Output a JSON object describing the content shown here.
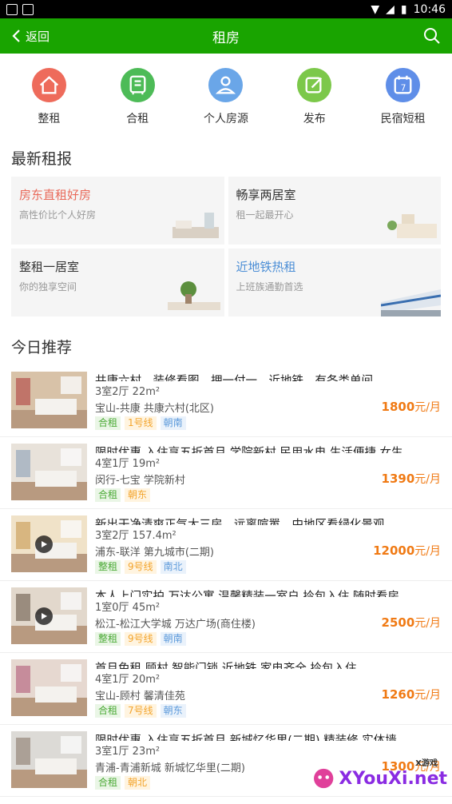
{
  "status": {
    "time": "10:46"
  },
  "header": {
    "back_label": "返回",
    "title": "租房"
  },
  "categories": [
    {
      "label": "整租",
      "color": "#ee6b5b",
      "icon": "home-icon"
    },
    {
      "label": "合租",
      "color": "#4dbb57",
      "icon": "building-icon"
    },
    {
      "label": "个人房源",
      "color": "#6aa6e8",
      "icon": "person-icon"
    },
    {
      "label": "发布",
      "color": "#7cc84a",
      "icon": "edit-icon"
    },
    {
      "label": "民宿短租",
      "color": "#5f8ee8",
      "icon": "calendar-icon"
    }
  ],
  "latest": {
    "title": "最新租报",
    "promos": [
      {
        "title": "房东直租好房",
        "sub": "高性价比个人好房",
        "color": "#e96a5a"
      },
      {
        "title": "畅享两居室",
        "sub": "租一起最开心",
        "color": "#333333"
      },
      {
        "title": "整租一居室",
        "sub": "你的独享空间",
        "color": "#333333"
      },
      {
        "title": "近地铁热租",
        "sub": "上班族通勤首选",
        "color": "#4d8fd6"
      }
    ]
  },
  "recommend": {
    "title": "今日推荐",
    "items": [
      {
        "title": "共康六村，装修看图，押一付一，近地铁，有各类单间，...",
        "layout": "3室2厅  22m²",
        "location": "宝山-共康  共康六村(北区)",
        "price": "1800",
        "unit": "元/月",
        "tags": [
          "合租",
          "1号线",
          "朝南"
        ],
        "video": false
      },
      {
        "title": "限时优惠 入住享五折首月 学院新村 民用水电 生活便捷 女生",
        "layout": "4室1厅  19m²",
        "location": "闵行-七宝  学院新村",
        "price": "1390",
        "unit": "元/月",
        "tags": [
          "合租",
          "朝东"
        ],
        "video": false
      },
      {
        "title": "新出干净清爽正气大三房，远离喧嚣，中地区看绿化景观...",
        "layout": "3室2厅  157.4m²",
        "location": "浦东-联洋  第九城市(二期)",
        "price": "12000",
        "unit": "元/月",
        "tags": [
          "整租",
          "9号线",
          "南北"
        ],
        "video": true
      },
      {
        "title": "本人上门实拍 万达公寓 温馨精装一室户 拎包入住 随时看房",
        "layout": "1室0厅  45m²",
        "location": "松江-松江大学城  万达广场(商住楼)",
        "price": "2500",
        "unit": "元/月",
        "tags": [
          "整租",
          "9号线",
          "朝南"
        ],
        "video": true
      },
      {
        "title": "首月免租 顾村 智能门锁 近地铁 家电齐全 拎包入住",
        "layout": "4室1厅  20m²",
        "location": "宝山-顾村  馨清佳苑",
        "price": "1260",
        "unit": "元/月",
        "tags": [
          "合租",
          "7号线",
          "朝东"
        ],
        "video": false
      },
      {
        "title": "限时优惠 入住享五折首月 新城忆华里(二期) 精装修 实体墙",
        "layout": "3室1厅  23m²",
        "location": "青浦-青浦新城  新城忆华里(二期)",
        "price": "1300",
        "unit": "元/月",
        "tags": [
          "合租",
          "朝北"
        ],
        "video": false
      }
    ]
  },
  "watermark": {
    "text": "XYouXi.net",
    "small": "X游戏"
  }
}
